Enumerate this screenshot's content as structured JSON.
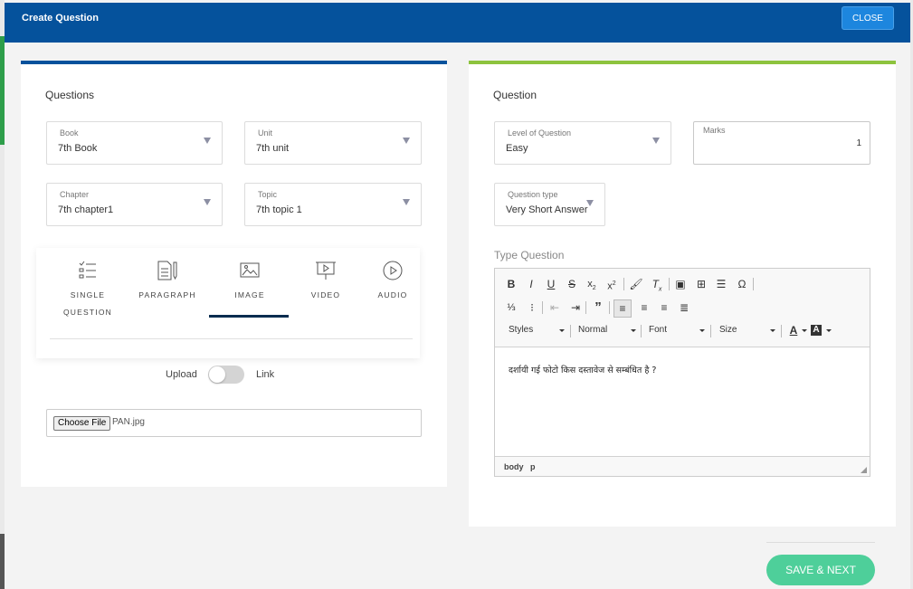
{
  "header": {
    "title": "Create Question",
    "close_label": "CLOSE"
  },
  "left": {
    "title": "Questions",
    "book": {
      "label": "Book",
      "value": "7th Book"
    },
    "unit": {
      "label": "Unit",
      "value": "7th unit"
    },
    "chapter": {
      "label": "Chapter",
      "value": "7th chapter1"
    },
    "topic": {
      "label": "Topic",
      "value": "7th topic 1"
    },
    "types": [
      {
        "line1": "SINGLE",
        "line2": "QUESTION",
        "icon": "list-check-icon"
      },
      {
        "line1": "PARAGRAPH",
        "line2": "",
        "icon": "paragraph-pen-icon"
      },
      {
        "line1": "IMAGE",
        "line2": "",
        "icon": "image-icon"
      },
      {
        "line1": "VIDEO",
        "line2": "",
        "icon": "video-presentation-icon"
      },
      {
        "line1": "AUDIO",
        "line2": "",
        "icon": "play-circle-icon"
      }
    ],
    "active_type": "IMAGE",
    "toggle": {
      "left_label": "Upload",
      "right_label": "Link"
    },
    "file": {
      "button_label": "Choose File",
      "file_name": "PAN.jpg"
    }
  },
  "right": {
    "title": "Question",
    "level": {
      "label": "Level of Question",
      "value": "Easy"
    },
    "marks": {
      "label": "Marks",
      "value": "1"
    },
    "qtype": {
      "label": "Question type",
      "value": "Very Short Answer"
    },
    "type_question_label": "Type Question",
    "editor": {
      "styles": "Styles",
      "format": "Normal",
      "font": "Font",
      "size": "Size",
      "content": "दर्शायी गई फोटो किस दस्तावेज से सम्बंधित है ?",
      "path": [
        "body",
        "p"
      ]
    }
  },
  "footer": {
    "save_label": "SAVE & NEXT"
  }
}
